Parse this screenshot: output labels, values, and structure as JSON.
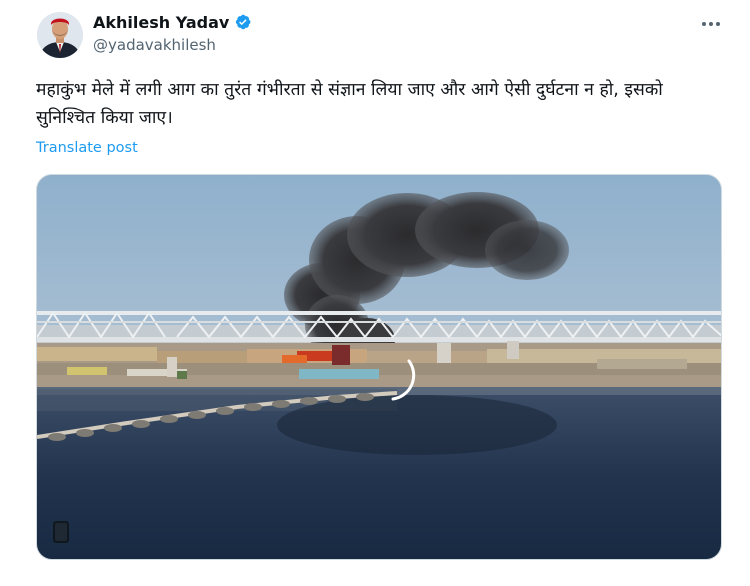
{
  "author": {
    "display_name": "Akhilesh Yadav",
    "handle": "@yadavakhilesh",
    "verified_icon": "verified-badge-icon",
    "avatar_icon": "avatar"
  },
  "post": {
    "text": "महाकुंभ मेले में लगी आग का तुरंत गंभीरता से संज्ञान लिया जाए और आगे ऐसी दुर्घटना न हो, इसको सुनिश्चित किया जाए।",
    "translate_label": "Translate post",
    "more_icon": "more-options-icon"
  },
  "media": {
    "type": "video",
    "player_icon": "video-playback-icon"
  },
  "colors": {
    "accent": "#1d9bf0",
    "text": "#0f1419",
    "secondary": "#536471"
  }
}
